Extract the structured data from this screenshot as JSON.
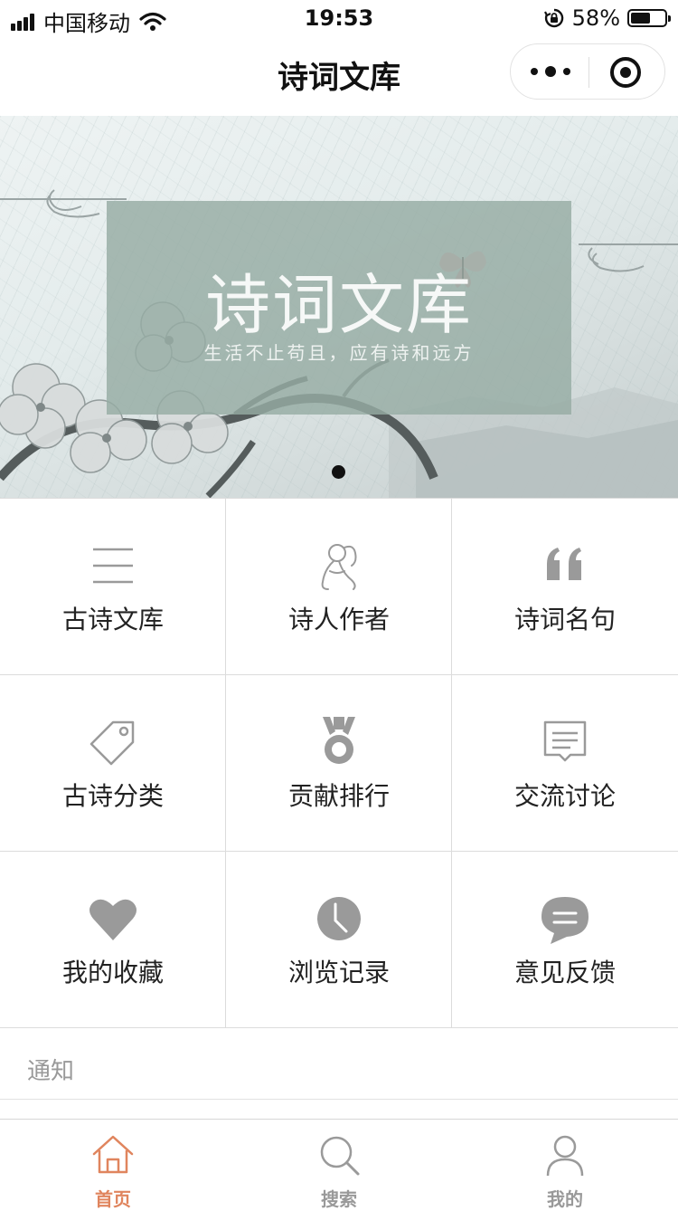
{
  "status_bar": {
    "carrier": "中国移动",
    "time": "19:53",
    "battery": "58%",
    "battery_level": 0.58
  },
  "nav": {
    "title": "诗词文库"
  },
  "banner": {
    "title": "诗词文库",
    "subtitle": "生活不止苟且，应有诗和远方"
  },
  "grid": {
    "items": [
      {
        "label": "古诗文库",
        "icon": "list-icon"
      },
      {
        "label": "诗人作者",
        "icon": "poet-icon"
      },
      {
        "label": "诗词名句",
        "icon": "quote-icon"
      },
      {
        "label": "古诗分类",
        "icon": "tag-icon"
      },
      {
        "label": "贡献排行",
        "icon": "medal-icon"
      },
      {
        "label": "交流讨论",
        "icon": "message-icon"
      },
      {
        "label": "我的收藏",
        "icon": "heart-icon"
      },
      {
        "label": "浏览记录",
        "icon": "clock-icon"
      },
      {
        "label": "意见反馈",
        "icon": "feedback-icon"
      }
    ]
  },
  "notice": {
    "label": "通知"
  },
  "tabs": [
    {
      "label": "首页",
      "icon": "home-icon",
      "active": true
    },
    {
      "label": "搜索",
      "icon": "search-icon",
      "active": false
    },
    {
      "label": "我的",
      "icon": "user-icon",
      "active": false
    }
  ],
  "colors": {
    "accent": "#e0855e",
    "icon_gray": "#9a9a9a",
    "banner_card": "#96aca4"
  }
}
